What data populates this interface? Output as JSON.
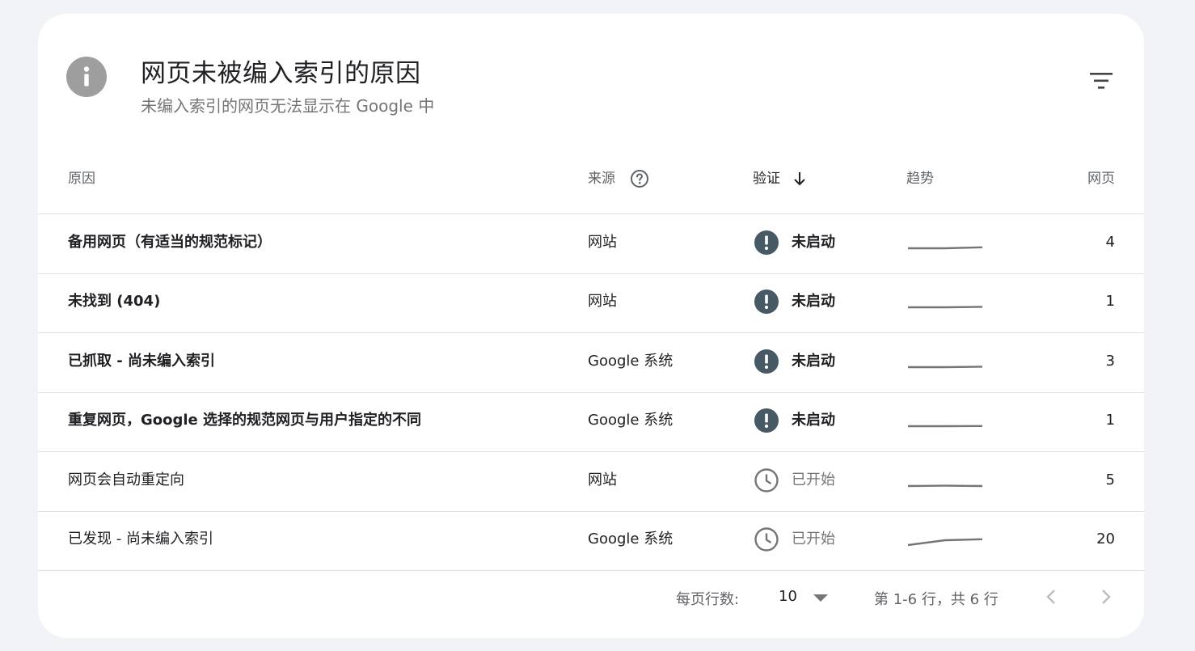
{
  "header": {
    "title": "网页未被编入索引的原因",
    "subtitle": "未编入索引的网页无法显示在 Google 中",
    "info_icon": "info-icon",
    "filter_icon": "filter-icon"
  },
  "table": {
    "columns": {
      "reason": "原因",
      "source": "来源",
      "validation": "验证",
      "trend": "趋势",
      "pages": "网页"
    },
    "sorted_column": "validation",
    "rows": [
      {
        "reason": "备用网页（有适当的规范标记）",
        "source": "网站",
        "status": "未启动",
        "status_type": "not-started",
        "trend": [
          4,
          4,
          5
        ],
        "pages": "4"
      },
      {
        "reason": "未找到 (404)",
        "source": "网站",
        "status": "未启动",
        "status_type": "not-started",
        "trend": [
          1,
          1,
          1.5
        ],
        "pages": "1"
      },
      {
        "reason": "已抓取 - 尚未编入索引",
        "source": "Google 系统",
        "status": "未启动",
        "status_type": "not-started",
        "trend": [
          3,
          3,
          3.5
        ],
        "pages": "3"
      },
      {
        "reason": "重复网页，Google 选择的规范网页与用户指定的不同",
        "source": "Google 系统",
        "status": "未启动",
        "status_type": "not-started",
        "trend": [
          1,
          1,
          1.2
        ],
        "pages": "1"
      },
      {
        "reason": "网页会自动重定向",
        "source": "网站",
        "status": "已开始",
        "status_type": "started",
        "trend": [
          5,
          5.3,
          5
        ],
        "pages": "5"
      },
      {
        "reason": "已发现 - 尚未编入索引",
        "source": "Google 系统",
        "status": "已开始",
        "status_type": "started",
        "trend": [
          14,
          19,
          20
        ],
        "pages": "20"
      }
    ]
  },
  "footer": {
    "rows_per_page_label": "每页行数:",
    "rows_per_page_value": "10",
    "range_text": "第 1-6 行，共 6 行"
  },
  "colors": {
    "accent_dark": "#455a64",
    "muted": "#757575",
    "trend_line": "#757575",
    "background": "#f1f3f6"
  }
}
